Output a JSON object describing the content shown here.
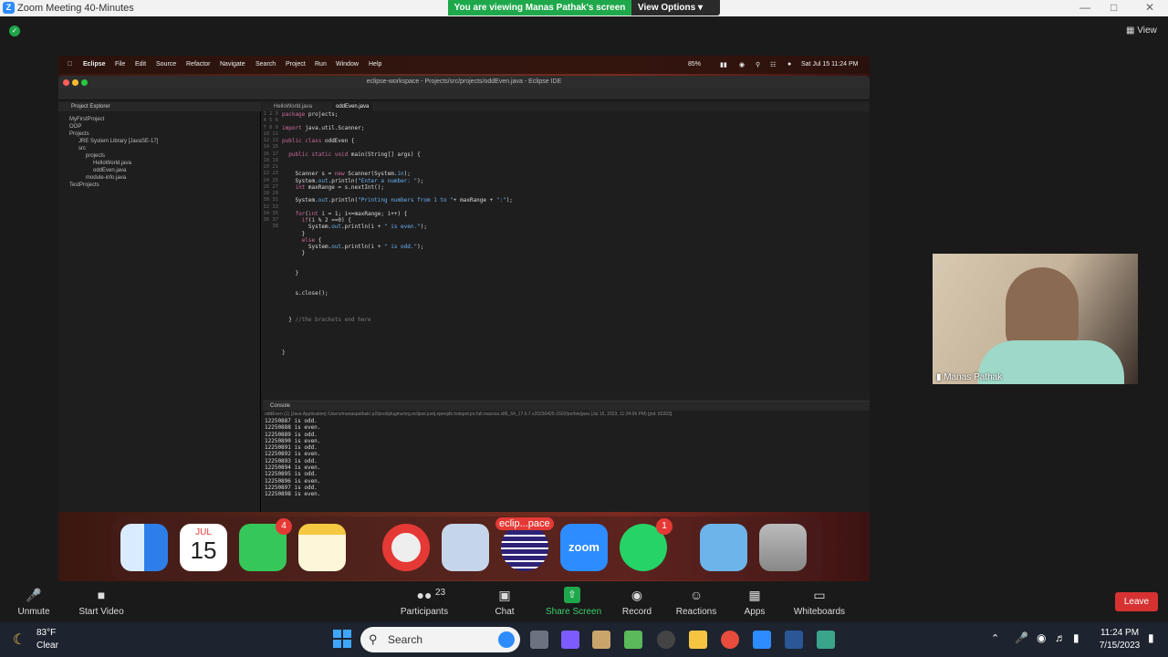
{
  "zoom": {
    "window_title": "Zoom Meeting 40-Minutes",
    "banner_text": "You are viewing Manas Pathak's screen",
    "view_options_label": "View Options",
    "view_label": "View",
    "participant_name": "Manas Pathak",
    "leave_label": "Leave",
    "controls": {
      "unmute": "Unmute",
      "start_video": "Start Video",
      "participants": "Participants",
      "participants_count": "23",
      "chat": "Chat",
      "share_screen": "Share Screen",
      "record": "Record",
      "reactions": "Reactions",
      "apps": "Apps",
      "whiteboards": "Whiteboards"
    }
  },
  "mac": {
    "menu": [
      "Eclipse",
      "File",
      "Edit",
      "Source",
      "Refactor",
      "Navigate",
      "Search",
      "Project",
      "Run",
      "Window",
      "Help"
    ],
    "battery": "85%",
    "datetime": "Sat Jul 15  11:24 PM",
    "dock_calendar_month": "JUL",
    "dock_calendar_day": "15",
    "dock_messages_badge": "4",
    "dock_whatsapp_badge": "1",
    "dock_eclipse_label": "eclip...pace",
    "dock_zoom_label": "zoom"
  },
  "eclipse": {
    "title": "eclipse-workspace - Projects/src/projects/oddEven.java - Eclipse IDE",
    "explorer_title": "Project Explorer",
    "tree": [
      "MyFirstProject",
      "OOP",
      "Projects",
      "JRE System Library [JavaSE-17]",
      "src",
      "projects",
      "HelloWorld.java",
      "oddEven.java",
      "module-info.java",
      "TestProjects"
    ],
    "tabs": [
      "HelloWorld.java",
      "oddEven.java"
    ],
    "line_numbers": "1\n2\n3\n4\n5\n6\n7\n8\n9\n10\n11\n12\n13\n14\n15\n16\n17\n18\n19\n20\n21\n22\n23\n24\n25\n26\n27\n28\n29\n30\n31\n32\n33\n34\n35\n36\n37\n38",
    "console_title": "Console",
    "console_path": "oddEven (1) [Java Application] /Users/manaspathak/.p2/pool/plugins/org.eclipse.justj.openjdk.hotspot.jre.full.macosx.x86_64_17.0.7.v20230425-1502/jre/bin/java  (Jul 15, 2023, 11:24:06 PM) [pid: 83203]",
    "console_output": "12250887 is odd.\n12250888 is even.\n12250889 is odd.\n12250890 is even.\n12250891 is odd.\n12250892 is even.\n12250893 is odd.\n12250894 is even.\n12250895 is odd.\n12250896 is even.\n12250897 is odd.\n12250898 is even."
  },
  "windows": {
    "weather_temp": "83°F",
    "weather_desc": "Clear",
    "search_placeholder": "Search",
    "time": "11:24 PM",
    "date": "7/15/2023"
  }
}
